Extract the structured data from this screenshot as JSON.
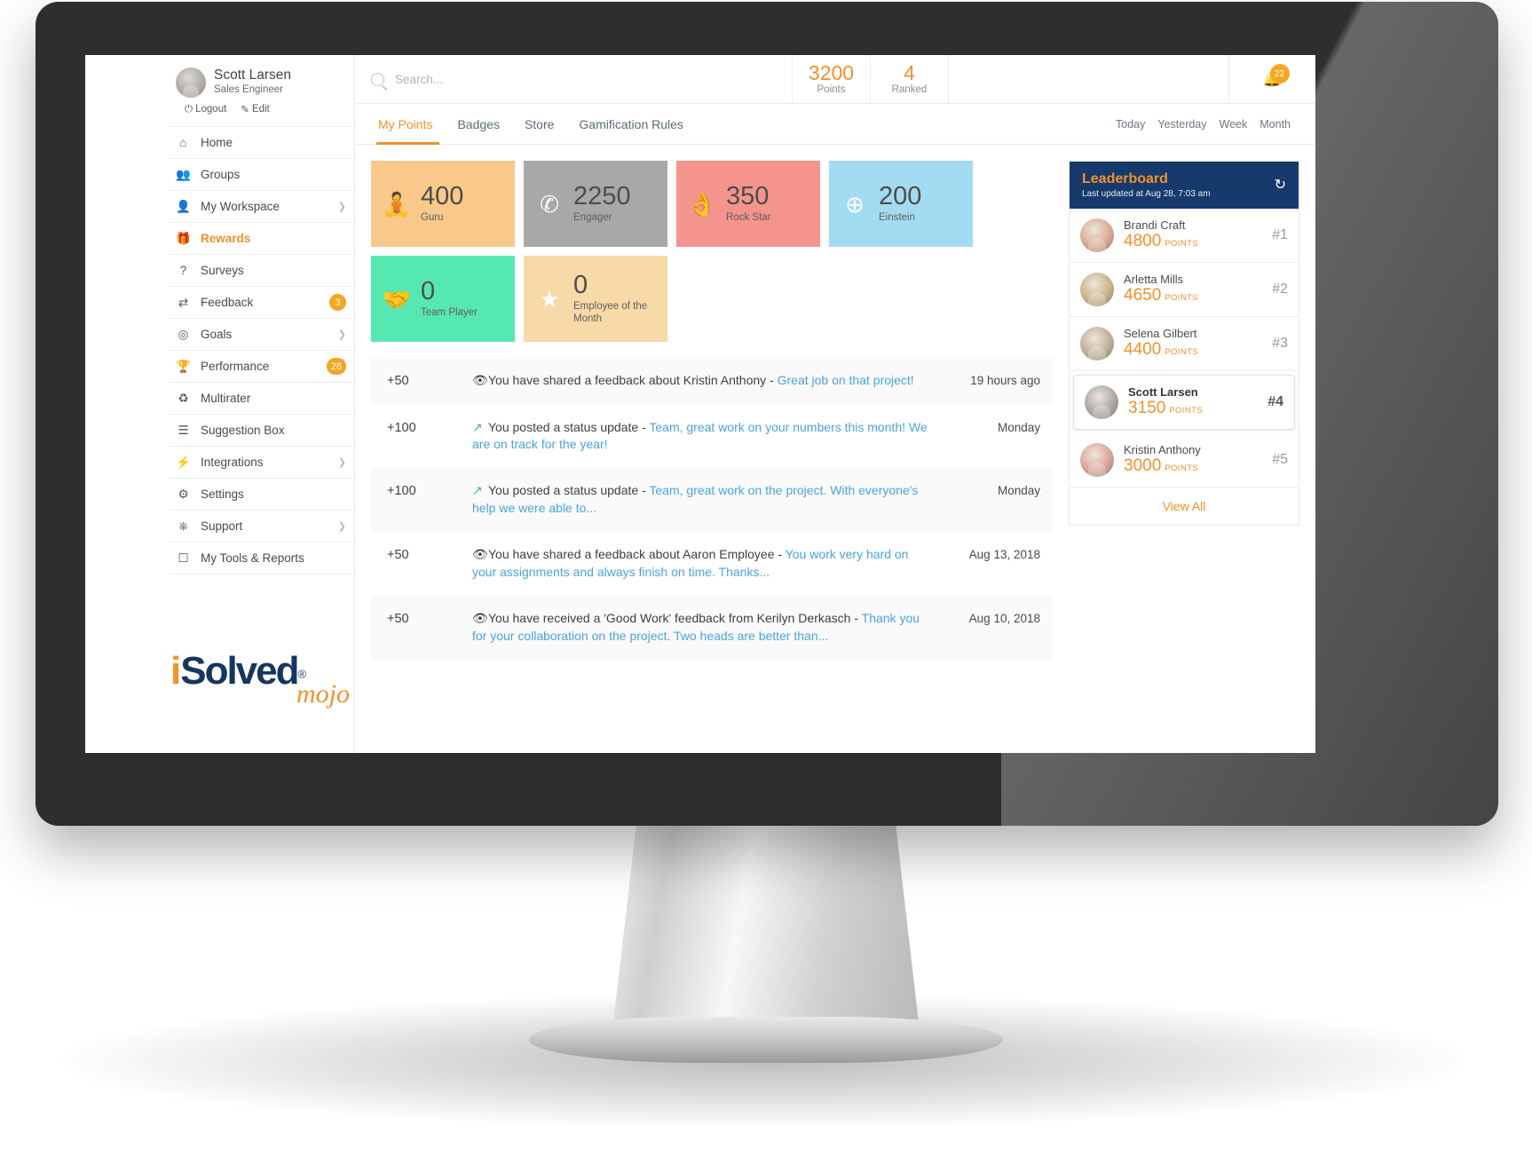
{
  "profile": {
    "name": "Scott Larsen",
    "role": "Sales Engineer",
    "logout_label": "Logout",
    "edit_label": "Edit",
    "power_icon": "power-icon",
    "pencil_icon": "pencil-icon"
  },
  "sidebar": {
    "items": [
      {
        "label": "Home",
        "icon": "home-icon",
        "glyph": "⌂",
        "badge": "",
        "chevron": false,
        "active": false
      },
      {
        "label": "Groups",
        "icon": "people-icon",
        "glyph": "👥",
        "badge": "",
        "chevron": false,
        "active": false
      },
      {
        "label": "My Workspace",
        "icon": "person-icon",
        "glyph": "👤",
        "badge": "",
        "chevron": true,
        "active": false
      },
      {
        "label": "Rewards",
        "icon": "gift-icon",
        "glyph": "🎁",
        "badge": "",
        "chevron": false,
        "active": true
      },
      {
        "label": "Surveys",
        "icon": "question-circle-icon",
        "glyph": "?",
        "badge": "",
        "chevron": false,
        "active": false
      },
      {
        "label": "Feedback",
        "icon": "exchange-icon",
        "glyph": "⇄",
        "badge": "3",
        "chevron": false,
        "active": false
      },
      {
        "label": "Goals",
        "icon": "target-icon",
        "glyph": "◎",
        "badge": "",
        "chevron": true,
        "active": false
      },
      {
        "label": "Performance",
        "icon": "trophy-icon",
        "glyph": "🏆",
        "badge": "28",
        "chevron": false,
        "active": false
      },
      {
        "label": "Multirater",
        "icon": "recycle-icon",
        "glyph": "♻",
        "badge": "",
        "chevron": false,
        "active": false
      },
      {
        "label": "Suggestion Box",
        "icon": "inbox-icon",
        "glyph": "☰",
        "badge": "",
        "chevron": false,
        "active": false
      },
      {
        "label": "Integrations",
        "icon": "plug-icon",
        "glyph": "⚡",
        "badge": "",
        "chevron": true,
        "active": false
      },
      {
        "label": "Settings",
        "icon": "gear-icon",
        "glyph": "⚙",
        "badge": "",
        "chevron": false,
        "active": false
      },
      {
        "label": "Support",
        "icon": "lifebuoy-icon",
        "glyph": "⎈",
        "badge": "",
        "chevron": true,
        "active": false
      },
      {
        "label": "My Tools & Reports",
        "icon": "box-icon",
        "glyph": "☐",
        "badge": "",
        "chevron": false,
        "active": false
      }
    ],
    "logo": {
      "i": "i",
      "solved": "Solved",
      "reg": "®",
      "mojo": "mojo"
    }
  },
  "topbar": {
    "search_placeholder": "Search...",
    "search_icon": "search-icon",
    "stats": [
      {
        "value": "3200",
        "label": "Points"
      },
      {
        "value": "4",
        "label": "Ranked"
      }
    ],
    "bell_icon": "bell-icon",
    "bell_count": "22"
  },
  "tabs": [
    {
      "label": "My Points",
      "active": true
    },
    {
      "label": "Badges",
      "active": false
    },
    {
      "label": "Store",
      "active": false
    },
    {
      "label": "Gamification Rules",
      "active": false
    }
  ],
  "filters": [
    "Today",
    "Yesterday",
    "Week",
    "Month"
  ],
  "tiles": [
    {
      "value": "400",
      "label": "Guru",
      "color": "#f8c98a",
      "icon": "meditation-icon",
      "glyph": "🧘"
    },
    {
      "value": "2250",
      "label": "Engager",
      "color": "#a8a8a8",
      "icon": "compass-icon",
      "glyph": "✆"
    },
    {
      "value": "350",
      "label": "Rock Star",
      "color": "#f4948d",
      "icon": "ok-hand-icon",
      "glyph": "👌"
    },
    {
      "value": "200",
      "label": "Einstein",
      "color": "#a3dcf2",
      "icon": "brain-badge-icon",
      "glyph": "⊕"
    },
    {
      "value": "0",
      "label": "Team Player",
      "color": "#56e8b3",
      "icon": "handshake-icon",
      "glyph": "🤝"
    },
    {
      "value": "0",
      "label": "Employee of the Month",
      "color": "#f8d9a8",
      "icon": "star-seal-icon",
      "glyph": "★"
    }
  ],
  "feed": [
    {
      "points": "+50",
      "icon": "eye-icon",
      "icon_color": "dark",
      "prefix": "You have shared a feedback about Kristin Anthony - ",
      "link": "Great job on that project!",
      "time": "19 hours ago"
    },
    {
      "points": "+100",
      "icon": "share-square-icon",
      "icon_color": "green",
      "prefix": "You posted a status update - ",
      "link": "Team, great work on your numbers this month!  We are on track for the year!",
      "time": "Monday"
    },
    {
      "points": "+100",
      "icon": "share-square-icon",
      "icon_color": "green",
      "prefix": "You posted a status update - ",
      "link": "Team, great work on the project. With everyone's help we were able to...",
      "time": "Monday"
    },
    {
      "points": "+50",
      "icon": "eye-icon",
      "icon_color": "dark",
      "prefix": "You have shared a feedback about Aaron Employee - ",
      "link": "You work very hard on your assignments and always finish on time. Thanks...",
      "time": "Aug 13, 2018"
    },
    {
      "points": "+50",
      "icon": "eye-icon",
      "icon_color": "dark",
      "prefix": "You have received a 'Good Work' feedback from Kerilyn Derkasch - ",
      "link": "Thank you for your collaboration on the project. Two heads are better than...",
      "time": "Aug 10, 2018"
    }
  ],
  "leaderboard": {
    "title": "Leaderboard",
    "subtitle": "Last updated at Aug 28, 7:03 am",
    "refresh_icon": "refresh-icon",
    "points_unit": "POINTS",
    "view_all": "View All",
    "rows": [
      {
        "name": "Brandi Craft",
        "points": "4800",
        "rank": "#1",
        "me": false,
        "avatar": "#d9a98f"
      },
      {
        "name": "Arletta Mills",
        "points": "4650",
        "rank": "#2",
        "me": false,
        "avatar": "#c9b286"
      },
      {
        "name": "Selena Gilbert",
        "points": "4400",
        "rank": "#3",
        "me": false,
        "avatar": "#bfae94"
      },
      {
        "name": "Scott Larsen",
        "points": "3150",
        "rank": "#4",
        "me": true,
        "avatar": "#a9a5a1"
      },
      {
        "name": "Kristin Anthony",
        "points": "3000",
        "rank": "#5",
        "me": false,
        "avatar": "#dba396"
      }
    ]
  },
  "colors": {
    "accent": "#f2912c",
    "link": "#4aa3df",
    "navy": "#163a6b"
  }
}
